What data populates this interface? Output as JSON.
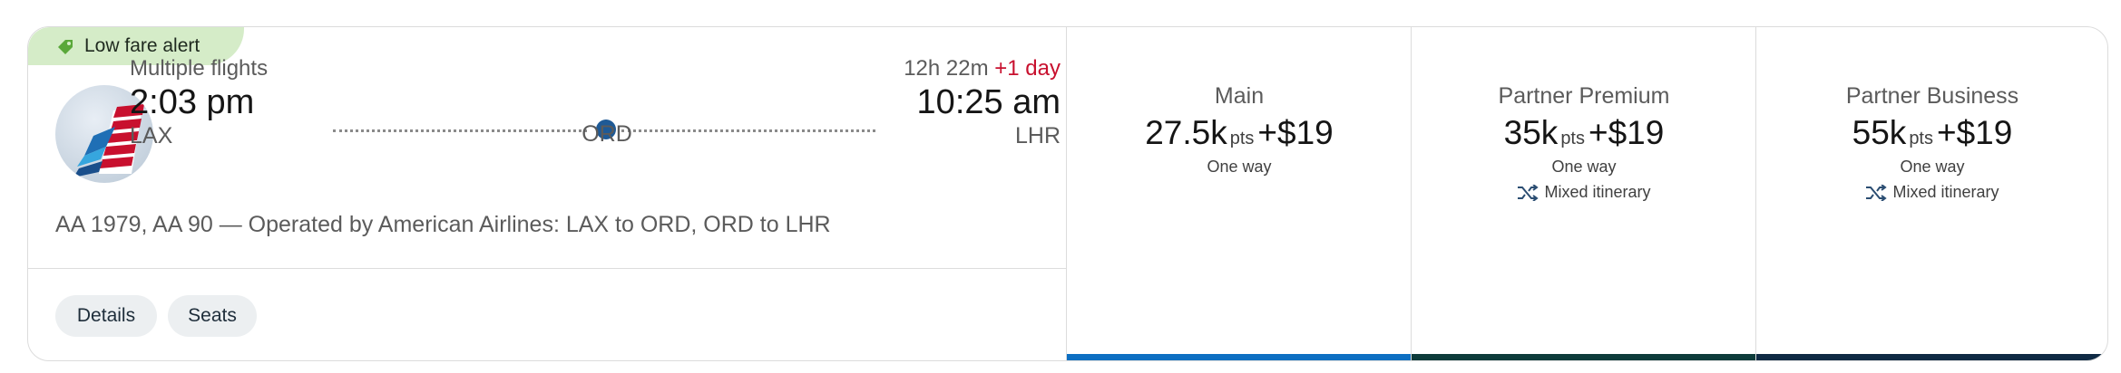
{
  "badge": {
    "label": "Low fare alert",
    "icon": "tag-icon",
    "color": "#d5ecc8"
  },
  "airline": {
    "logo": "american-airlines-tail-logo"
  },
  "flight": {
    "type_label": "Multiple flights",
    "depart_time": "2:03 pm",
    "depart_airport": "LAX",
    "stop_airport": "ORD",
    "duration": "12h 22m",
    "day_offset": "+1 day",
    "arrive_time": "10:25 am",
    "arrive_airport": "LHR",
    "operated_by": "AA 1979, AA 90 — Operated by American Airlines: LAX to ORD, ORD to LHR"
  },
  "actions": {
    "details_label": "Details",
    "seats_label": "Seats"
  },
  "fares": [
    {
      "name": "Main",
      "points": "27.5k",
      "pts_label": "pts",
      "plus": "+",
      "cash": "$19",
      "trip": "One way",
      "note": "",
      "bar_color": "#0d6fc2"
    },
    {
      "name": "Partner Premium",
      "points": "35k",
      "pts_label": "pts",
      "plus": "+",
      "cash": "$19",
      "trip": "One way",
      "note": "Mixed itinerary",
      "bar_color": "#0d3b3a"
    },
    {
      "name": "Partner Business",
      "points": "55k",
      "pts_label": "pts",
      "plus": "+",
      "cash": "$19",
      "trip": "One way",
      "note": "Mixed itinerary",
      "bar_color": "#0f2a44"
    }
  ],
  "colors": {
    "accent_blue": "#1f5a96",
    "day_offset_red": "#c8102e"
  }
}
